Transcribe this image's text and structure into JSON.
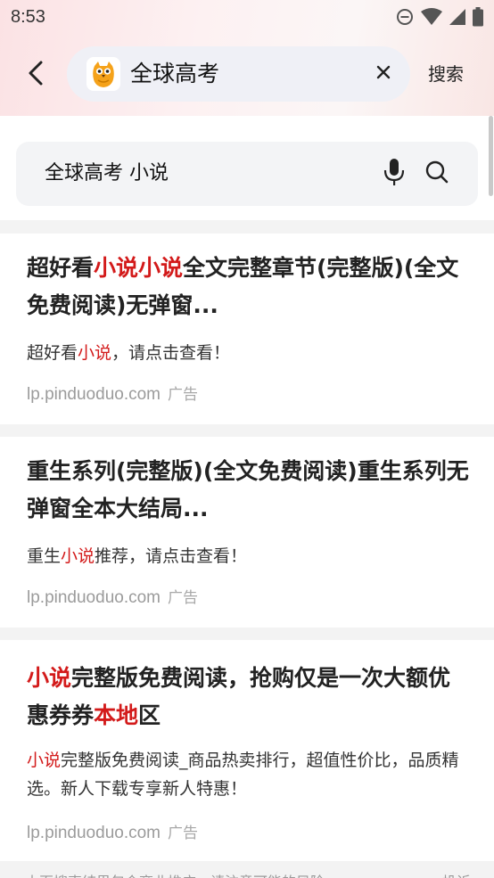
{
  "status_bar": {
    "time": "8:53"
  },
  "header": {
    "title": "全球高考",
    "search_label": "搜索"
  },
  "search": {
    "query": "全球高考 小说"
  },
  "results": [
    {
      "title_parts": [
        {
          "text": "超好看",
          "hl": false
        },
        {
          "text": "小说小说",
          "hl": true
        },
        {
          "text": "全文完整章节(完整版)(全文免费阅读)无弹窗...",
          "hl": false
        }
      ],
      "desc_parts": [
        {
          "text": "超好看",
          "hl": false
        },
        {
          "text": "小说",
          "hl": true
        },
        {
          "text": "，请点击查看！",
          "hl": false
        }
      ],
      "source": "lp.pinduoduo.com",
      "ad_label": "广告"
    },
    {
      "title_parts": [
        {
          "text": "重生系列(完整版)(全文免费阅读)重生系列无弹窗全本大结局...",
          "hl": false
        }
      ],
      "desc_parts": [
        {
          "text": "重生",
          "hl": false
        },
        {
          "text": "小说",
          "hl": true
        },
        {
          "text": "推荐，请点击查看！",
          "hl": false
        }
      ],
      "source": "lp.pinduoduo.com",
      "ad_label": "广告"
    },
    {
      "title_parts": [
        {
          "text": "小说",
          "hl": true
        },
        {
          "text": "完整版免费阅读，抢购仅是一次大额优惠券券",
          "hl": false
        },
        {
          "text": "本地",
          "hl": true
        },
        {
          "text": "区",
          "hl": false
        }
      ],
      "desc_parts": [
        {
          "text": "小说",
          "hl": true
        },
        {
          "text": "完整版免费阅读_商品热卖排行，超值性价比，品质精选。新人下载专享新人特惠！",
          "hl": false
        }
      ],
      "source": "lp.pinduoduo.com",
      "ad_label": "广告"
    }
  ],
  "footer": {
    "notice": "本页搜索结果包含商业推广，请注意可能的风险",
    "right_label": "投诉"
  },
  "colors": {
    "highlight": "#d31a1a",
    "source_gray": "#9b9b9b"
  },
  "icons": [
    "back-arrow-icon",
    "owl-app-logo-icon",
    "close-icon",
    "microphone-icon",
    "search-icon",
    "dnd-icon",
    "wifi-icon",
    "signal-icon",
    "battery-icon"
  ]
}
